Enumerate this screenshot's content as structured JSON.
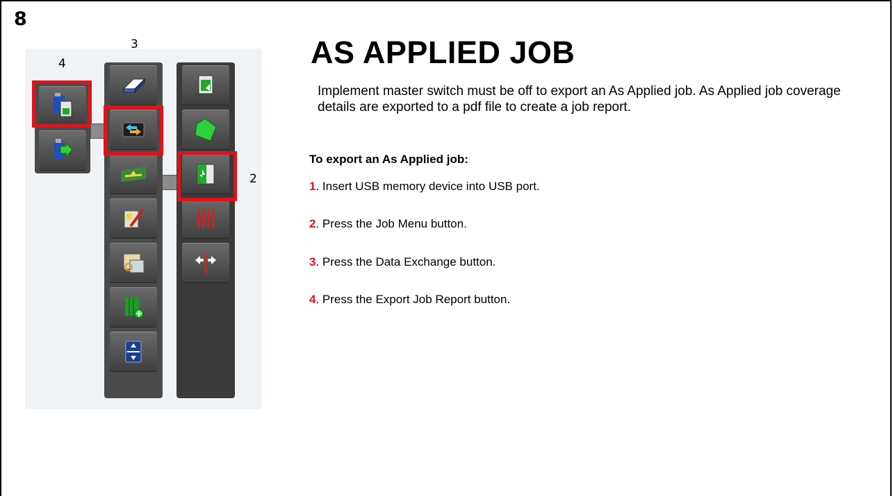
{
  "slide_number": "8",
  "title": "AS APPLIED JOB",
  "intro": "Implement master switch must be off to export an As Applied job. As Applied job coverage details are exported to a pdf file to create a job report.",
  "subheading": "To export an As Applied job:",
  "steps": [
    {
      "num": "1",
      "text": ". Insert USB memory device into USB port."
    },
    {
      "num": "2",
      "text": ". Press the Job Menu button."
    },
    {
      "num": "3",
      "text": ". Press the Data Exchange button."
    },
    {
      "num": "4",
      "text": ". Press the Export Job Report button."
    }
  ],
  "illustration": {
    "callouts": [
      "3",
      "4",
      "2"
    ],
    "highlight_color": "#e0121a",
    "menu_column": [
      {
        "icon": "eraser-icon"
      },
      {
        "icon": "data-exchange-icon"
      },
      {
        "icon": "field-boundary-icon"
      },
      {
        "icon": "edit-map-icon"
      },
      {
        "icon": "map-layers-icon"
      },
      {
        "icon": "add-coverage-icon"
      },
      {
        "icon": "scroll-arrows-icon"
      }
    ],
    "right_column": [
      {
        "icon": "job-export-icon"
      },
      {
        "icon": "field-icon"
      },
      {
        "icon": "job-menu-icon"
      },
      {
        "icon": "guidance-lines-icon"
      },
      {
        "icon": "nudge-icon"
      }
    ],
    "submenu": [
      {
        "icon": "export-job-report-icon"
      },
      {
        "icon": "usb-export-icon"
      }
    ]
  }
}
